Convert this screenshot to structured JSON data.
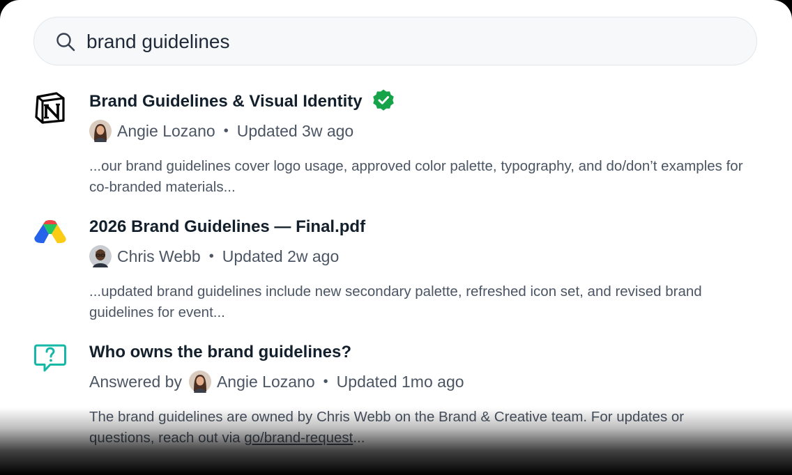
{
  "search": {
    "value": "brand guidelines",
    "icon": "search-icon"
  },
  "results": [
    {
      "source_icon": "notion-icon",
      "title": "Brand Guidelines & Visual Identity",
      "verified": true,
      "verified_color": "#16a34a",
      "author": "Angie Lozano",
      "updated": "Updated 3w ago",
      "snippet": "...our brand guidelines cover logo usage, approved color palette, typography, and do/don’t examples for co-branded materials..."
    },
    {
      "source_icon": "google-drive-icon",
      "title": "2026 Brand Guidelines — Final.pdf",
      "verified": false,
      "author": "Chris Webb",
      "updated": "Updated 2w ago",
      "snippet": "...updated brand guidelines include new secondary palette, refreshed icon set, and revised brand guidelines for event..."
    },
    {
      "source_icon": "question-bubble-icon",
      "source_icon_color": "#14b8a6",
      "title": "Who owns the brand guidelines?",
      "verified": false,
      "answered_by_label": "Answered by",
      "author": "Angie Lozano",
      "updated": "Updated 1mo ago",
      "snippet_prefix": "The brand guidelines are owned by Chris Webb on the Brand & Creative team. For updates or questions, reach out via ",
      "snippet_link": "go/brand-request",
      "snippet_suffix": "..."
    }
  ],
  "separator": "•",
  "colors": {
    "text_primary": "#13202c",
    "text_secondary": "#4b5563",
    "search_bg": "#f6f8fa"
  }
}
